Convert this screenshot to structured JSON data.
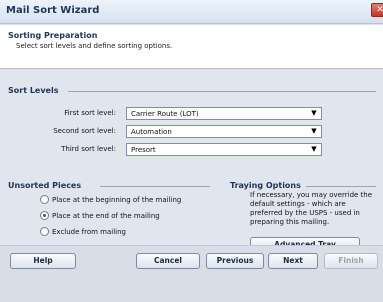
{
  "window": {
    "title": "Mail Sort Wizard",
    "close_glyph": "✕"
  },
  "header": {
    "title": "Sorting Preparation",
    "subtitle": "Select sort levels and define sorting options."
  },
  "sort_levels": {
    "heading": "Sort Levels",
    "rows": [
      {
        "label": "First sort level:",
        "value": "Carrier Route (LOT)"
      },
      {
        "label": "Second sort level:",
        "value": "Automation"
      },
      {
        "label": "Third sort level:",
        "value": "Presort"
      }
    ]
  },
  "unsorted_pieces": {
    "heading": "Unsorted Pieces",
    "options": [
      {
        "label": "Place at the beginning  of the mailing",
        "selected": false
      },
      {
        "label": "Place at the end of the mailing",
        "selected": true
      },
      {
        "label": "Exclude from mailing",
        "selected": false
      }
    ]
  },
  "traying_options": {
    "heading": "Traying Options",
    "description": "If necessary, you may override the default settings - which are preferred by the USPS - used in preparing this mailing.",
    "button_label": "Advanced Tray Settings..."
  },
  "footer": {
    "help": "Help",
    "cancel": "Cancel",
    "previous": "Previous",
    "next": "Next",
    "finish": "Finish"
  },
  "icons": {
    "dropdown_arrow": "▼"
  }
}
